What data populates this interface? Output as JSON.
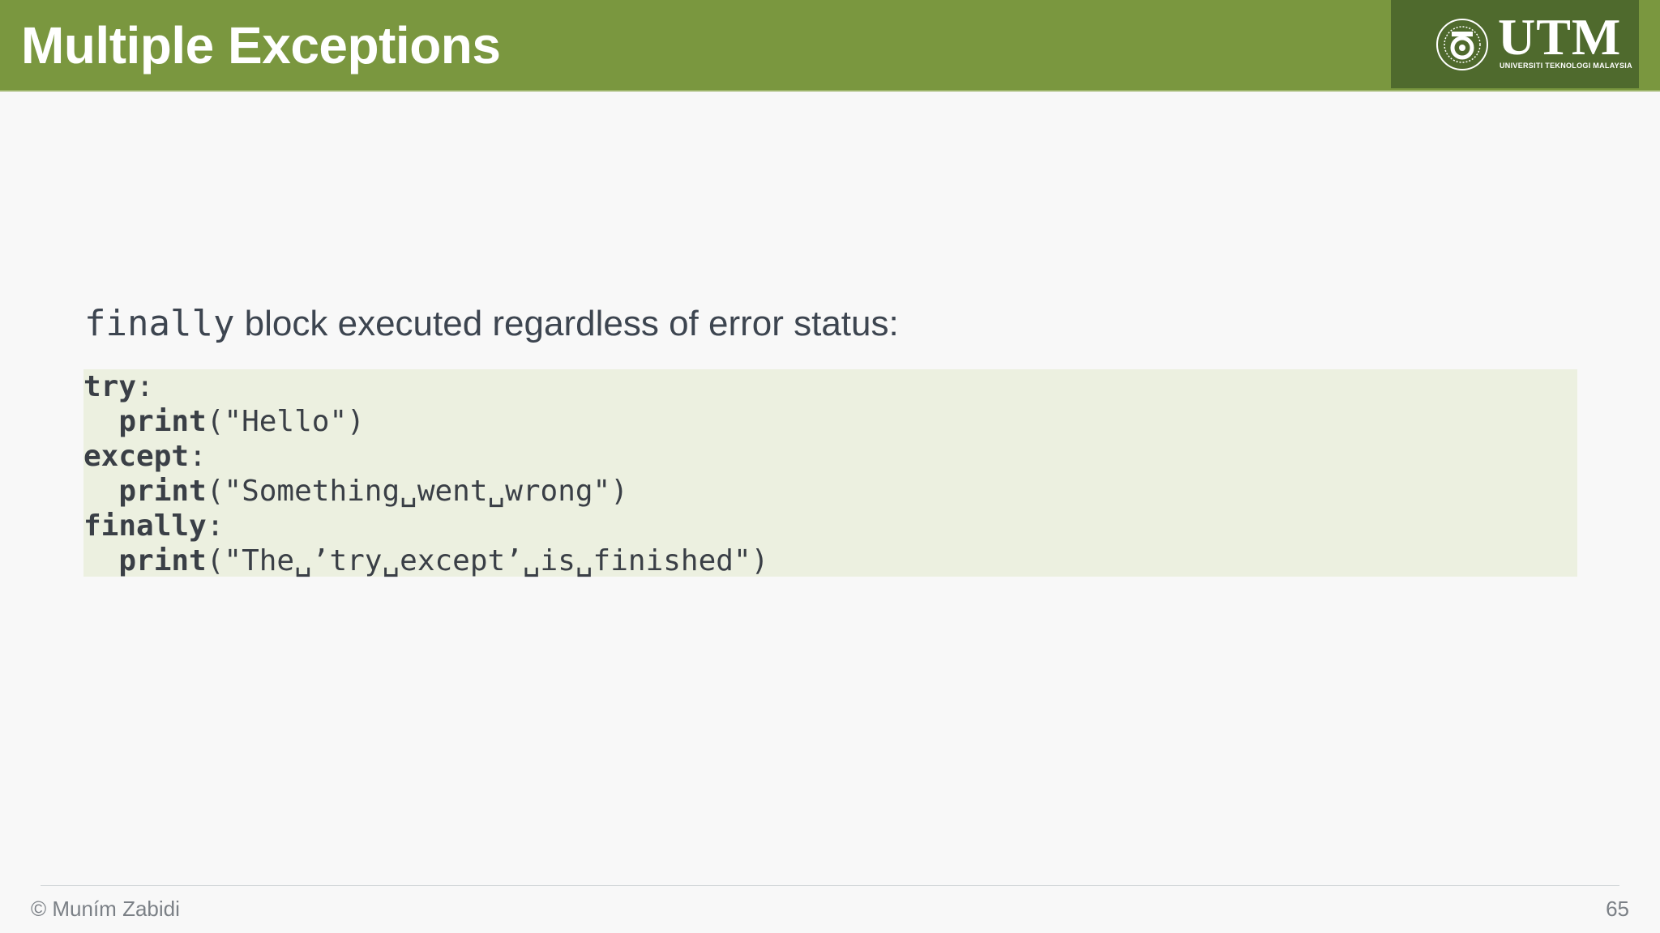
{
  "slide": {
    "title": "Multiple Exceptions",
    "logo": {
      "name": "UTM",
      "subtitle": "UNIVERSITI TEKNOLOGI MALAYSIA",
      "icon": "utm-seal-icon"
    },
    "lead": {
      "keyword": "finally",
      "text": " block executed regardless of error status:"
    },
    "code": [
      {
        "keyword": "try",
        "rest": ":"
      },
      {
        "indent": "  ",
        "keyword": "print",
        "rest": "(\"Hello\")"
      },
      {
        "keyword": "except",
        "rest": ":"
      },
      {
        "indent": "  ",
        "keyword": "print",
        "rest": "(\"Something␣went␣wrong\")"
      },
      {
        "keyword": "finally",
        "rest": ":"
      },
      {
        "indent": "  ",
        "keyword": "print",
        "rest": "(\"The␣’try␣except’␣is␣finished\")"
      }
    ],
    "footer": {
      "author": "© Muním Zabidi",
      "page": "65"
    }
  },
  "colors": {
    "header": "#7a973f",
    "logo_box": "#4f6a2d",
    "code_bg": "#ecf0e0",
    "text": "#3d4550"
  }
}
